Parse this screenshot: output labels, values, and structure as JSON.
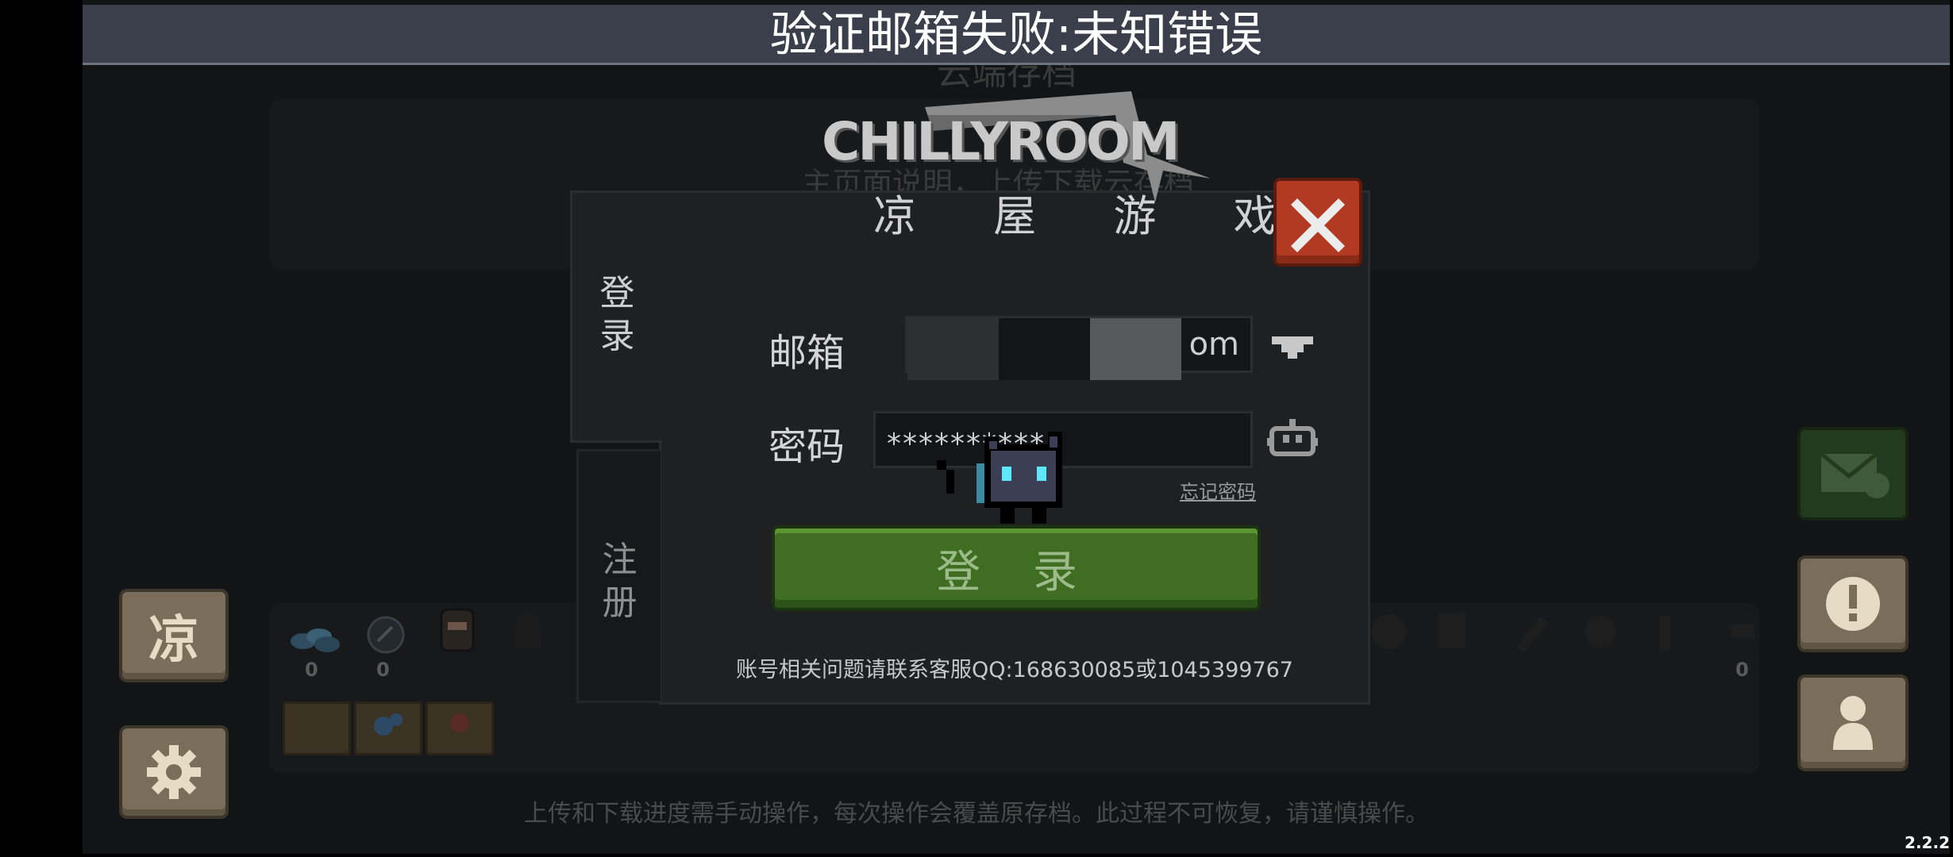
{
  "toast": {
    "message": "验证邮箱失败:未知错误"
  },
  "logo": {
    "brand": "CHILLYROOM",
    "studio_name": "凉 屋 游 戏"
  },
  "login_dialog": {
    "tabs": [
      {
        "label": "登\n录",
        "selected": true
      },
      {
        "label": "注\n册",
        "selected": false
      }
    ],
    "email": {
      "label": "邮箱",
      "visible_suffix": "om"
    },
    "password": {
      "label": "密码",
      "value": "********** "
    },
    "forgot_password": "忘记密码",
    "login_button": "登 录",
    "support_text": "账号相关问题请联系客服QQ:168630085或1045399767"
  },
  "background": {
    "notice": "上传和下载进度需手动操作，每次操作会覆盖原存档。此过程不可恢复，请谨慎操作。",
    "inventory_counts": [
      "0",
      "0",
      "0"
    ],
    "left_top_button_glyph": "凉"
  },
  "colors": {
    "toast_bg": "#3b3f4b",
    "dialog_bg": "#1f2022",
    "login_green": "#3f6e22",
    "close_red": "#b23a22",
    "side_button_tan": "#7a6e5a"
  },
  "version": "2.2.2"
}
